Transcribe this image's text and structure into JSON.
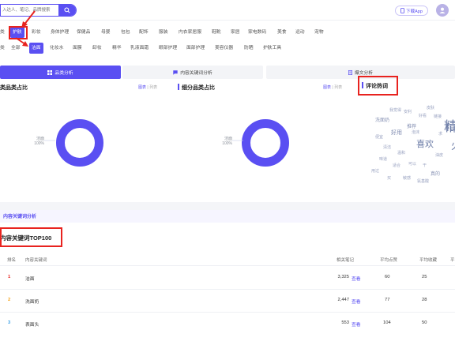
{
  "header": {
    "search_placeholder": "入达人、笔记、品牌搜索",
    "download_label": "下载App"
  },
  "categories_row1": {
    "items": [
      "类",
      "护肤",
      "彩妆",
      "身体护理",
      "保健品",
      "母婴",
      "包包",
      "配饰",
      "服装",
      "内衣家居服",
      "鞋靴",
      "家居",
      "家电数码",
      "美食",
      "运动",
      "宠物"
    ],
    "active": "护肤"
  },
  "categories_row2": {
    "items": [
      "类",
      "全部",
      "洁面",
      "化妆水",
      "面膜",
      "卸妆",
      "精华",
      "乳液面霜",
      "眼部护理",
      "面部护理",
      "美容仪器",
      "防晒",
      "护肤工具"
    ],
    "active": "洁面"
  },
  "tabs": [
    {
      "label": "品类分析",
      "icon": "grid-icon",
      "active": true
    },
    {
      "label": "内容关键词分析",
      "icon": "chat-icon",
      "active": false
    },
    {
      "label": "爆文分析",
      "icon": "document-icon",
      "active": false
    }
  ],
  "panels": {
    "left_title": "类品类占比",
    "middle_title": "细分品类占比",
    "right_title": "评论热词",
    "toggle_on": "图表",
    "toggle_off": "列表"
  },
  "chart_data": [
    {
      "type": "pie",
      "title": "类品类占比",
      "labels": [
        "洁面"
      ],
      "values": [
        100
      ],
      "value_labels": [
        "100%"
      ],
      "colors": [
        "#5a4ff2"
      ]
    },
    {
      "type": "pie",
      "title": "细分品类占比",
      "labels": [
        "洁面"
      ],
      "values": [
        100
      ],
      "value_labels": [
        "100%"
      ],
      "colors": [
        "#5a4ff2"
      ]
    }
  ],
  "word_cloud": [
    {
      "text": "精",
      "size": 17,
      "color": "#6e7ea8"
    },
    {
      "text": "喜欢",
      "size": 11,
      "color": "#6e7ea8"
    },
    {
      "text": "fu",
      "size": 14,
      "color": "#6e7ea8"
    },
    {
      "text": "火",
      "size": 13,
      "color": "#6e7ea8"
    },
    {
      "text": "好用",
      "size": 7,
      "color": "#7f8bb0"
    },
    {
      "text": "洗面奶",
      "size": 6,
      "color": "#8893b5"
    },
    {
      "text": "推荐",
      "size": 6,
      "color": "#8893b5"
    },
    {
      "text": "我觉得",
      "size": 5,
      "color": "#9aa3c1"
    },
    {
      "text": "安利",
      "size": 5,
      "color": "#9aa3c1"
    },
    {
      "text": "好看",
      "size": 5,
      "color": "#9aa3c1"
    },
    {
      "text": "清洁",
      "size": 5,
      "color": "#9aa3c1"
    },
    {
      "text": "温和",
      "size": 5,
      "color": "#9aa3c1"
    },
    {
      "text": "可以",
      "size": 5,
      "color": "#9aa3c1"
    },
    {
      "text": "皮肤",
      "size": 5,
      "color": "#9aa3c1"
    },
    {
      "text": "链接",
      "size": 5,
      "color": "#9aa3c1"
    },
    {
      "text": "求",
      "size": 5,
      "color": "#9aa3c1"
    },
    {
      "text": "泡沫",
      "size": 5,
      "color": "#9aa3c1"
    },
    {
      "text": "味道",
      "size": 5,
      "color": "#9aa3c1"
    },
    {
      "text": "干",
      "size": 5,
      "color": "#9aa3c1"
    },
    {
      "text": "适合",
      "size": 5,
      "color": "#9aa3c1"
    },
    {
      "text": "油皮",
      "size": 5,
      "color": "#9aa3c1"
    },
    {
      "text": "便宜",
      "size": 5,
      "color": "#9aa3c1"
    },
    {
      "text": "真的",
      "size": 6,
      "color": "#8893b5"
    },
    {
      "text": "买",
      "size": 5,
      "color": "#9aa3c1"
    },
    {
      "text": "敏感",
      "size": 5,
      "color": "#9aa3c1"
    },
    {
      "text": "氨基酸",
      "size": 5,
      "color": "#9aa3c1"
    },
    {
      "text": "用过",
      "size": 5,
      "color": "#9aa3c1"
    }
  ],
  "sections": {
    "content_keyword_tab": "内容关键词分析",
    "top100_title": "内容关键词TOP100"
  },
  "table": {
    "headers": [
      "排名",
      "内容关键词",
      "相关笔记",
      "平均点赞",
      "平均收藏",
      "平"
    ],
    "rows": [
      {
        "rank": "1",
        "keyword": "洁面",
        "notes": "3,325",
        "link": "查看",
        "avg_likes": "60",
        "avg_favs": "25"
      },
      {
        "rank": "2",
        "keyword": "洗面奶",
        "notes": "2,447",
        "link": "查看",
        "avg_likes": "77",
        "avg_favs": "28"
      },
      {
        "rank": "3",
        "keyword": "表面头",
        "notes": "553",
        "link": "查看",
        "avg_likes": "104",
        "avg_favs": "50"
      }
    ],
    "rank_colors": [
      "#e8231f",
      "#f5a31a",
      "#3aa0e6"
    ]
  }
}
